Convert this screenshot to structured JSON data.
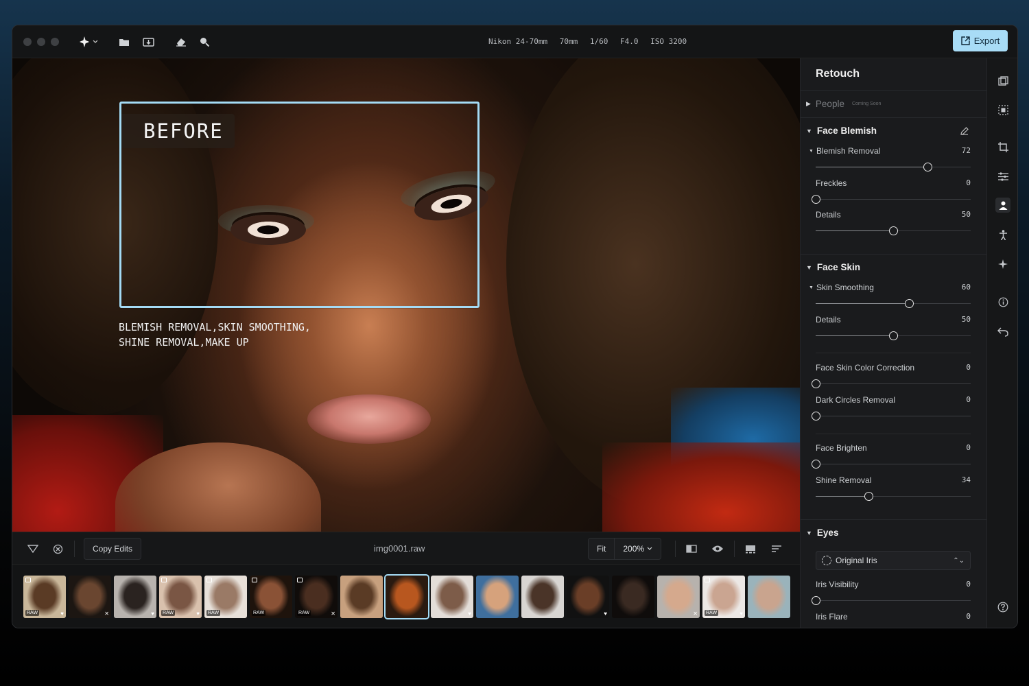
{
  "toolbar": {
    "camera": [
      "Nikon 24-70mm",
      "70mm",
      "1/60",
      "F4.0",
      "ISO 3200"
    ],
    "export_label": "Export"
  },
  "canvas": {
    "before_label": "BEFORE",
    "caption_line1": "BLEMISH REMOVAL,SKIN SMOOTHING,",
    "caption_line2": "SHINE REMOVAL,MAKE UP"
  },
  "bottombar": {
    "copy_edits": "Copy Edits",
    "filename": "img0001.raw",
    "fit": "Fit",
    "zoom": "200%"
  },
  "filmstrip": {
    "thumbs": [
      {
        "raw": "RAW",
        "heart": true,
        "colors": [
          "#c9b79a",
          "#5a3b25"
        ]
      },
      {
        "raw": "",
        "close": true,
        "colors": [
          "#1c1612",
          "#6a4630"
        ]
      },
      {
        "raw": "",
        "heart": true,
        "colors": [
          "#b8b3ae",
          "#2a2320"
        ]
      },
      {
        "raw": "RAW",
        "heart": true,
        "colors": [
          "#d9c1ad",
          "#7a5644"
        ]
      },
      {
        "raw": "RAW",
        "heart": false,
        "colors": [
          "#e7e0d9",
          "#9a7a66"
        ]
      },
      {
        "raw": "RAW",
        "heart": false,
        "colors": [
          "#1e130c",
          "#8a5236"
        ]
      },
      {
        "raw": "RAW",
        "close": true,
        "colors": [
          "#100c0a",
          "#4a2e20"
        ]
      },
      {
        "raw": "",
        "heart": false,
        "colors": [
          "#c7a07e",
          "#5a3b25"
        ]
      },
      {
        "raw": "",
        "heart": false,
        "selected": true,
        "colors": [
          "#2a1a10",
          "#b8571f"
        ]
      },
      {
        "raw": "",
        "heart": true,
        "colors": [
          "#e3ddd8",
          "#7d5c49"
        ]
      },
      {
        "raw": "",
        "heart": false,
        "colors": [
          "#3f6f9e",
          "#d6a27c"
        ]
      },
      {
        "raw": "",
        "heart": false,
        "colors": [
          "#d8d5d2",
          "#4a3428"
        ]
      },
      {
        "raw": "",
        "heart": true,
        "colors": [
          "#111",
          "#6a3e27"
        ]
      },
      {
        "raw": "",
        "heart": false,
        "colors": [
          "#0f0c0b",
          "#3a2a22"
        ]
      },
      {
        "raw": "",
        "close": true,
        "colors": [
          "#b7b2ad",
          "#d5a98d"
        ]
      },
      {
        "raw": "RAW",
        "heart": true,
        "colors": [
          "#ece8e5",
          "#caa591"
        ]
      },
      {
        "raw": "",
        "heart": false,
        "colors": [
          "#9ab3bb",
          "#c9a48e"
        ]
      }
    ]
  },
  "panel": {
    "title": "Retouch",
    "people": "People",
    "people_soon": "Coming Soon",
    "face_blemish": {
      "title": "Face Blemish",
      "sliders": [
        {
          "label": "Blemish Removal",
          "value": "72",
          "v": 72,
          "caret": true
        },
        {
          "label": "Freckles",
          "value": "0",
          "v": 0
        },
        {
          "label": "Details",
          "value": "50",
          "v": 50
        }
      ]
    },
    "face_skin": {
      "title": "Face Skin",
      "sliders": [
        {
          "label": "Skin Smoothing",
          "value": "60",
          "v": 60,
          "caret": true
        },
        {
          "label": "Details",
          "value": "50",
          "v": 50
        },
        {
          "label": "Face Skin Color Correction",
          "value": "0",
          "v": 0
        },
        {
          "label": "Dark Circles Removal",
          "value": "0",
          "v": 0
        },
        {
          "label": "Face Brighten",
          "value": "0",
          "v": 0
        },
        {
          "label": "Shine Removal",
          "value": "34",
          "v": 34
        }
      ]
    },
    "eyes": {
      "title": "Eyes",
      "iris_select": "Original Iris",
      "sliders": [
        {
          "label": "Iris Visibility",
          "value": "0",
          "v": 0
        },
        {
          "label": "Iris Flare",
          "value": "0",
          "v": 0
        }
      ]
    }
  }
}
